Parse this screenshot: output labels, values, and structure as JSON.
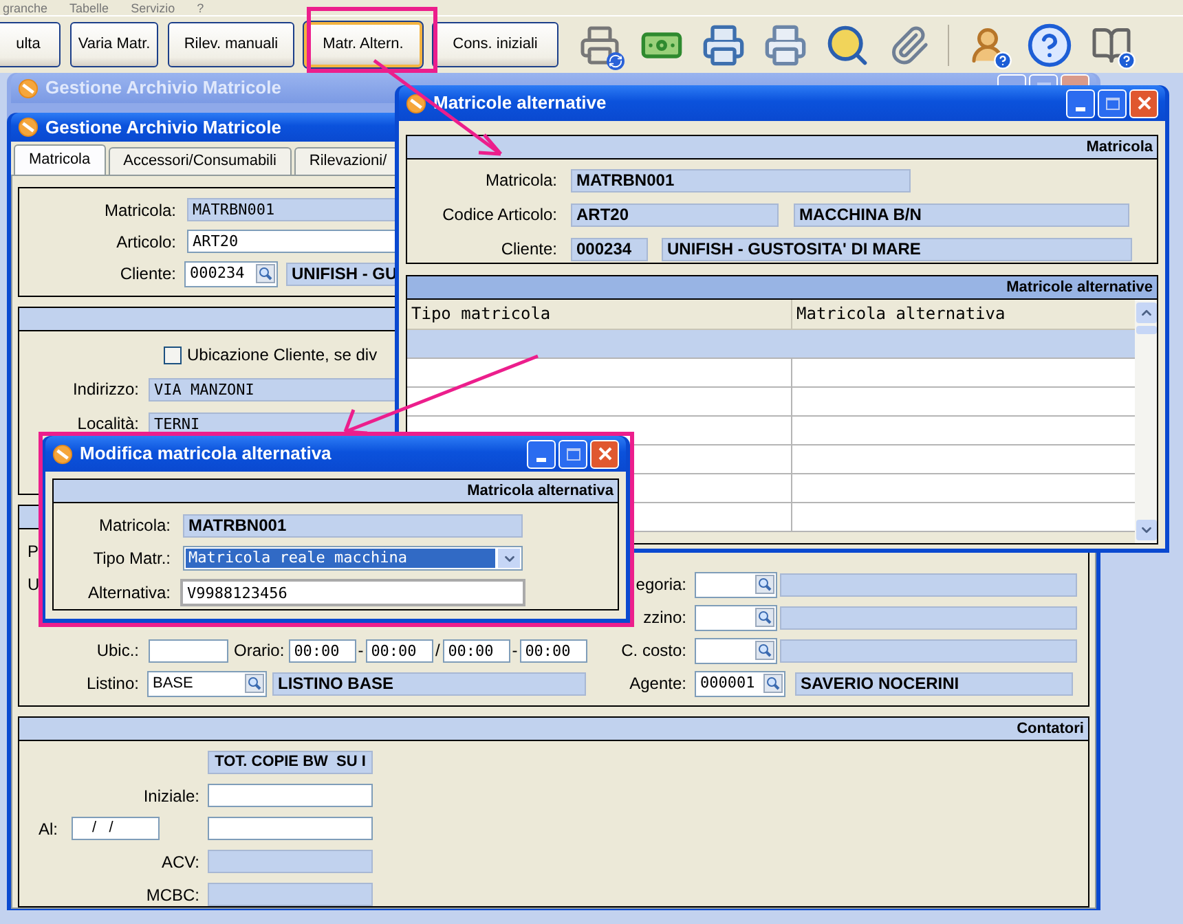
{
  "menu": [
    {
      "label": "granche"
    },
    {
      "label": "Tabelle"
    },
    {
      "label": "Servizio"
    },
    {
      "label": "?"
    }
  ],
  "toolbar": [
    {
      "label": "ulta",
      "focused": false
    },
    {
      "label": "Varia Matr.",
      "focused": false
    },
    {
      "label": "Rilev. manuali",
      "focused": false
    },
    {
      "label": "Matr. Altern.",
      "focused": true
    },
    {
      "label": "Cons. iniziali",
      "focused": false
    }
  ],
  "back_window": {
    "title": "Gestione Archivio Matricole",
    "active": false
  },
  "main_window": {
    "title": "Gestione Archivio Matricole",
    "active": true,
    "tabs": [
      {
        "label": "Matricola",
        "selected": true
      },
      {
        "label": "Accessori/Consumabili",
        "selected": false
      },
      {
        "label": "Rilevazioni/",
        "selected": false
      }
    ],
    "identity": [
      {
        "label": "Matricola:",
        "value": "MATRBN001",
        "kind": "readonly"
      },
      {
        "label": "Articolo:",
        "value": "ART20",
        "kind": "input"
      },
      {
        "label": "Cliente:",
        "value": "000234",
        "kind": "lookup",
        "description": "UNIFISH - GU"
      }
    ],
    "location": {
      "checkbox": {
        "label": "Ubicazione Cliente, se div",
        "checked": false
      },
      "fields": [
        {
          "label": "Indirizzo:",
          "value": "VIA MANZONI"
        },
        {
          "label": "Località:",
          "value": "TERNI"
        }
      ]
    },
    "details": {
      "left_labels": [
        "P",
        "U"
      ],
      "right_rows": [
        {
          "label": "egoria:"
        },
        {
          "label": "zzino:"
        },
        {
          "label": "C. costo:"
        }
      ],
      "ubic": {
        "label": "Ubic.:"
      },
      "orario": {
        "label": "Orario:",
        "times": [
          "00:00",
          "00:00",
          "00:00",
          "00:00"
        ],
        "separators": [
          "-",
          "/",
          "-"
        ]
      },
      "listino": {
        "label": "Listino:",
        "value": "BASE",
        "description": "LISTINO BASE"
      },
      "agente": {
        "label": "Agente:",
        "value": "000001",
        "description": "SAVERIO NOCERINI"
      }
    },
    "counters": {
      "title": "Contatori",
      "column": "TOT. COPIE BW  SU I",
      "rows": [
        {
          "label": "Iniziale:",
          "kind": "input"
        },
        {
          "label": "Al:",
          "kind": "dated",
          "date": "/   /"
        },
        {
          "label": "ACV:",
          "kind": "readonly"
        },
        {
          "label": "MCBC:",
          "kind": "readonly"
        }
      ]
    }
  },
  "alt_window": {
    "title": "Matricole alternative",
    "active": true,
    "section": "Matricola",
    "matricola": {
      "label": "Matricola:",
      "value": "MATRBN001"
    },
    "articolo": {
      "label": "Codice Articolo:",
      "value": "ART20",
      "description": "MACCHINA B/N"
    },
    "cliente": {
      "label": "Cliente:",
      "value": "000234",
      "description": "UNIFISH - GUSTOSITA' DI MARE"
    },
    "table": {
      "title": "Matricole alternative",
      "columns": [
        "Tipo matricola",
        "Matricola alternativa"
      ],
      "rows": [
        {
          "selected": true
        },
        {
          "selected": false
        },
        {
          "selected": false
        },
        {
          "selected": false
        },
        {
          "selected": false
        },
        {
          "selected": false
        },
        {
          "selected": false
        }
      ]
    }
  },
  "modal": {
    "title": "Modifica matricola alternativa",
    "active": true,
    "section": "Matricola alternativa",
    "matricola": {
      "label": "Matricola:",
      "value": "MATRBN001"
    },
    "tipo": {
      "label": "Tipo Matr.:",
      "value": "Matricola reale macchina",
      "selected": true
    },
    "alternativa": {
      "label": "Alternativa:",
      "value": "V9988123456"
    }
  }
}
